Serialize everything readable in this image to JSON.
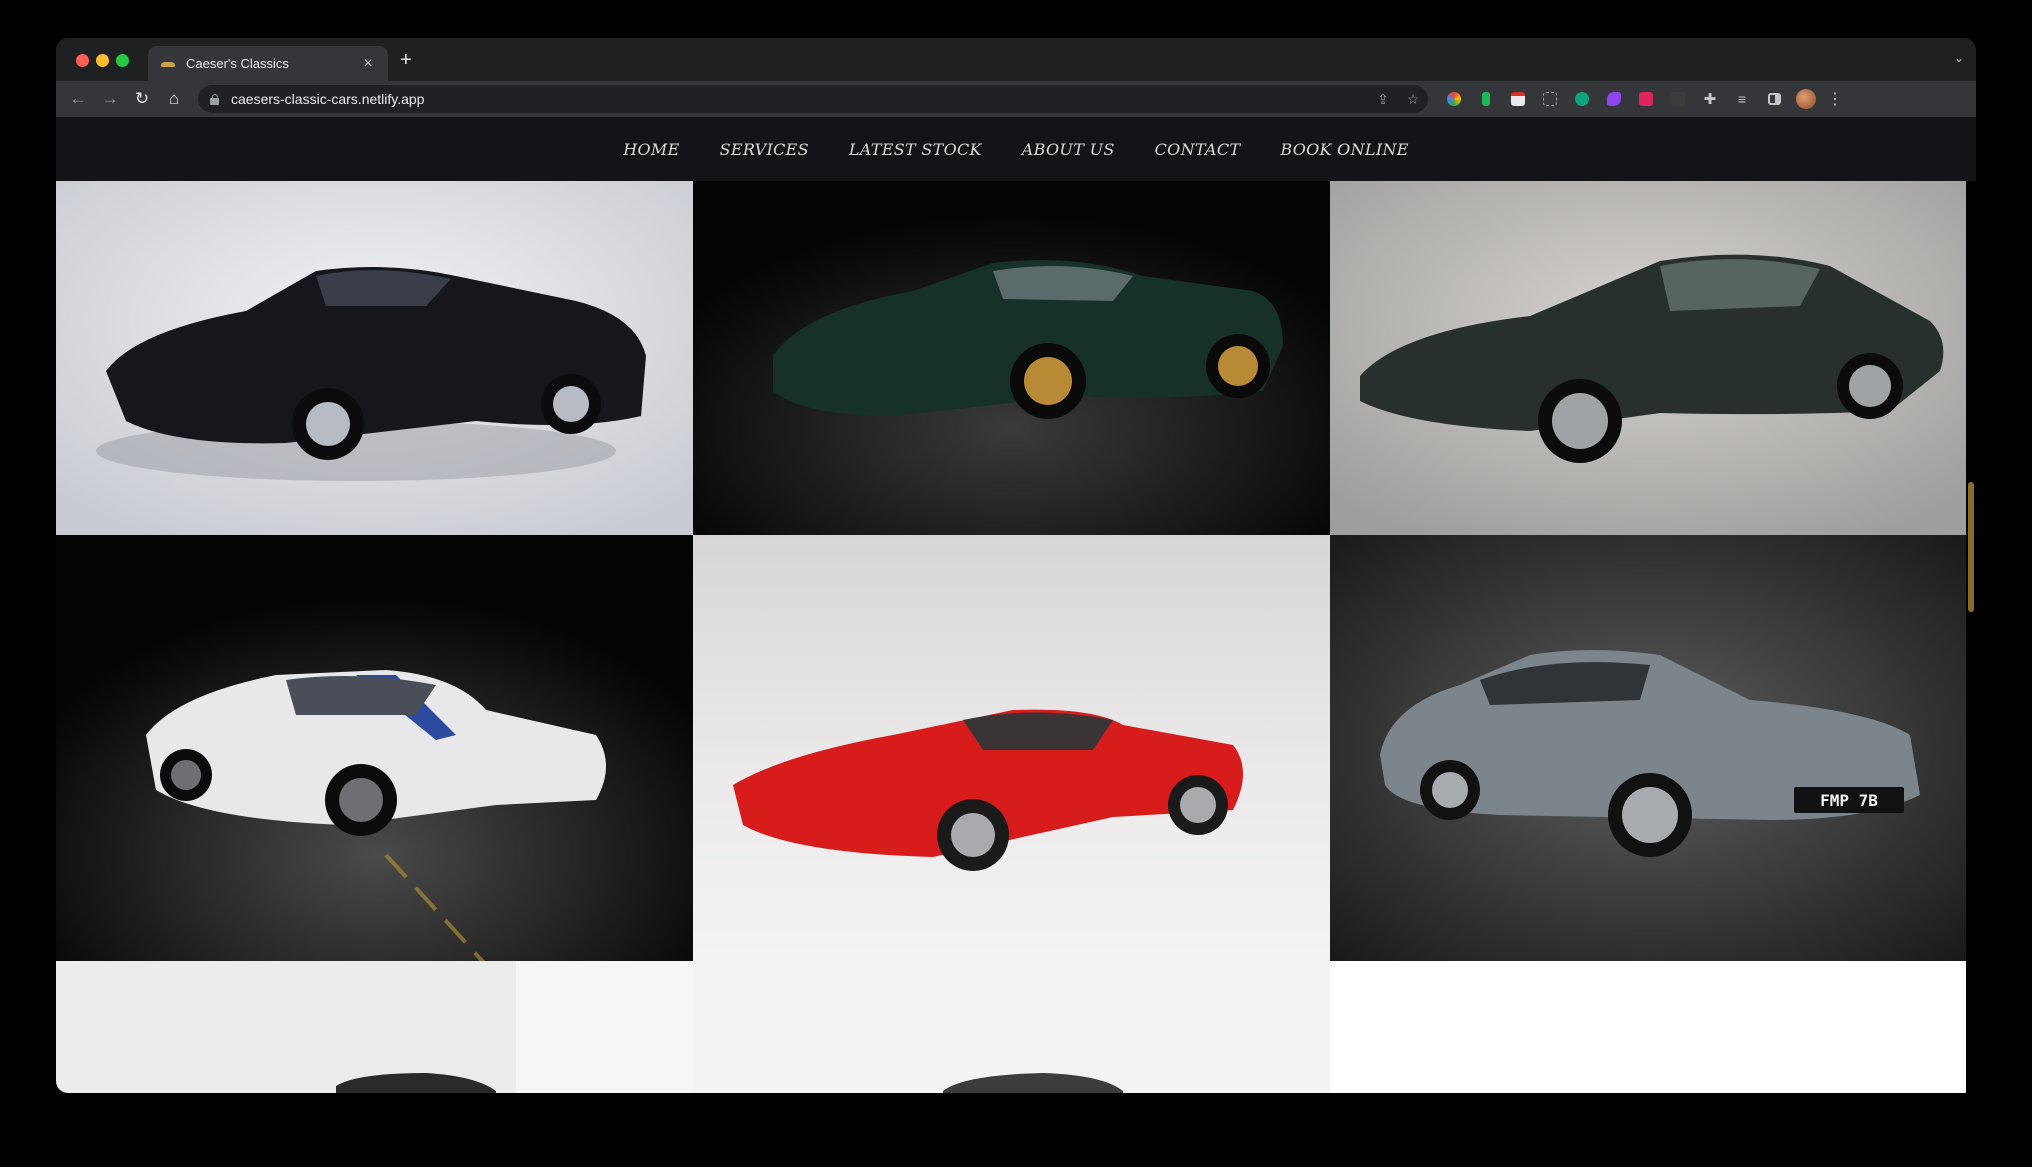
{
  "browser": {
    "tab_title": "Caeser's Classics",
    "tab_close": "×",
    "new_tab": "+",
    "url": "caesers-classic-cars.netlify.app"
  },
  "nav": {
    "items": [
      "HOME",
      "SERVICES",
      "LATEST STOCK",
      "ABOUT US",
      "CONTACT",
      "BOOK ONLINE"
    ]
  },
  "gallery": {
    "plate_text": "FMP 7B",
    "images": [
      "black-corvette-stingray",
      "dark-green-lamborghini-miura",
      "dark-green-jaguar-e-type",
      "white-shelby-mustang-blue-stripes",
      "red-ferrari-308",
      "silver-aston-martin-db5",
      "classic-car-partial",
      "classic-car-partial-2",
      "empty-white"
    ]
  },
  "colors": {
    "nav_bg": "#121417",
    "accent": "#8b6b2a"
  }
}
